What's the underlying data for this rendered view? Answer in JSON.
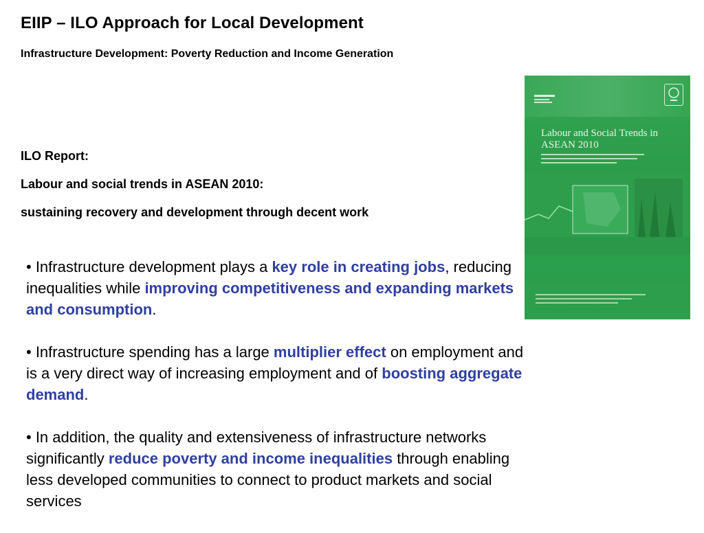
{
  "header": {
    "title": "EIIP – ILO Approach for Local Development",
    "subtitle": "Infrastructure Development: Poverty Reduction and Income Generation"
  },
  "report": {
    "line1": "ILO Report:",
    "line2": "Labour and social trends in ASEAN 2010:",
    "line3": "sustaining recovery and development through decent work"
  },
  "bullets": [
    {
      "parts": [
        {
          "text": "• Infrastructure development plays a ",
          "hl": false
        },
        {
          "text": "key role in creating jobs",
          "hl": true
        },
        {
          "text": ", reducing inequalities while ",
          "hl": false
        },
        {
          "text": "improving competitiveness and expanding markets and consumption",
          "hl": true
        },
        {
          "text": ".",
          "hl": false
        }
      ]
    },
    {
      "parts": [
        {
          "text": "• Infrastructure spending has a large ",
          "hl": false
        },
        {
          "text": "multiplier effect",
          "hl": true
        },
        {
          "text": " on employment and is a very direct way of increasing employment and of ",
          "hl": false
        },
        {
          "text": "boosting aggregate demand",
          "hl": true
        },
        {
          "text": ".",
          "hl": false
        }
      ]
    },
    {
      "parts": [
        {
          "text": "• In addition, the quality and extensiveness of infrastructure networks significantly ",
          "hl": false
        },
        {
          "text": "reduce poverty and income inequalities",
          "hl": true
        },
        {
          "text": " through enabling less developed communities to connect to product markets and social services",
          "hl": false
        }
      ]
    }
  ],
  "cover": {
    "title": "Labour and Social Trends in ASEAN 2010",
    "image_name": "report-cover-image"
  },
  "colors": {
    "highlight": "#2f3fa0",
    "cover_green": "#2fa54f"
  }
}
